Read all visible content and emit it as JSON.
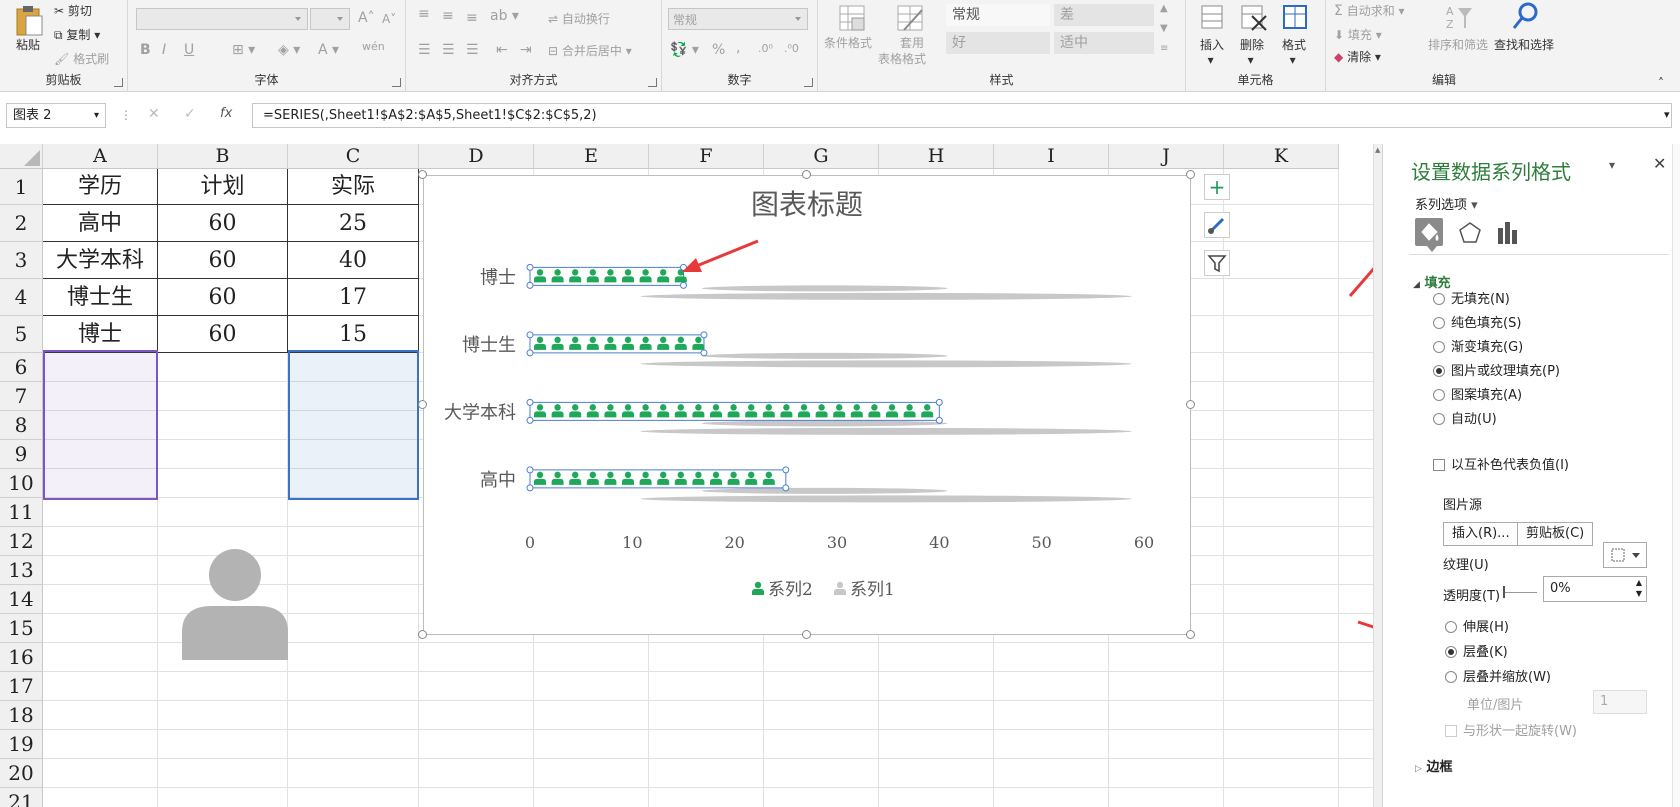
{
  "ribbon": {
    "clipboard": {
      "paste": "粘贴",
      "cut": "剪切",
      "copy": "复制",
      "format_painter": "格式刷",
      "label": "剪贴板"
    },
    "font": {
      "label": "字体",
      "bold": "B",
      "italic": "I",
      "underline": "U",
      "wen": "wén"
    },
    "alignment": {
      "wrap": "自动换行",
      "merge": "合并后居中",
      "label": "对齐方式"
    },
    "number": {
      "format": "常规",
      "percent": "%",
      "comma": ",",
      "label": "数字"
    },
    "styles": {
      "conditional": "条件格式",
      "table_fmt_1": "套用",
      "table_fmt_2": "表格格式",
      "normal": "常规",
      "bad": "差",
      "good": "好",
      "neutral": "适中",
      "label": "样式"
    },
    "cells": {
      "insert": "插入",
      "delete": "删除",
      "format": "格式",
      "label": "单元格"
    },
    "editing": {
      "autosum": "自动求和",
      "fill": "填充",
      "clear": "清除",
      "sort": "排序和筛选",
      "find": "查找和选择",
      "label": "编辑"
    }
  },
  "formula_bar": {
    "name_box": "图表 2",
    "fx": "fx",
    "formula": "=SERIES(,Sheet1!$A$2:$A$5,Sheet1!$C$2:$C$5,2)"
  },
  "sheet": {
    "columns": [
      "A",
      "B",
      "C",
      "D",
      "E",
      "F",
      "G",
      "H",
      "I",
      "J",
      "K"
    ],
    "rows": [
      "1",
      "2",
      "3",
      "4",
      "5",
      "6",
      "7",
      "8",
      "9",
      "10",
      "11",
      "12",
      "13",
      "14",
      "15",
      "16",
      "17",
      "18",
      "19",
      "20",
      "21"
    ],
    "header": [
      "学历",
      "计划",
      "实际"
    ],
    "data": [
      [
        "高中",
        "60",
        "25"
      ],
      [
        "大学本科",
        "60",
        "40"
      ],
      [
        "博士生",
        "60",
        "17"
      ],
      [
        "博士",
        "60",
        "15"
      ]
    ]
  },
  "chart_data": {
    "type": "bar",
    "title": "图表标题",
    "categories": [
      "博士",
      "博士生",
      "大学本科",
      "高中"
    ],
    "series": [
      {
        "name": "系列2",
        "values": [
          15,
          17,
          40,
          25
        ],
        "color": "#1fa85a"
      },
      {
        "name": "系列1",
        "values": [
          60,
          60,
          60,
          60
        ],
        "color": "#c8c8c8"
      }
    ],
    "xticks": [
      "0",
      "10",
      "20",
      "30",
      "40",
      "50",
      "60"
    ],
    "xlim": [
      0,
      60
    ],
    "legend": "bottom"
  },
  "pane": {
    "title": "设置数据系列格式",
    "series_options": "系列选项",
    "fill_section": "填充",
    "fill_options": [
      "无填充(N)",
      "纯色填充(S)",
      "渐变填充(G)",
      "图片或纹理填充(P)",
      "图案填充(A)",
      "自动(U)"
    ],
    "invert": "以互补色代表负值(I)",
    "picture_source": "图片源",
    "insert_btn": "插入(R)...",
    "clipboard_btn": "剪贴板(C)",
    "texture": "纹理(U)",
    "transparency": "透明度(T)",
    "transparency_value": "0%",
    "stretch": "伸展(H)",
    "stack": "层叠(K)",
    "stack_scale": "层叠并缩放(W)",
    "unit_label": "单位/图片",
    "unit_value": "1",
    "rotate": "与形状一起旋转(W)",
    "border": "边框"
  }
}
